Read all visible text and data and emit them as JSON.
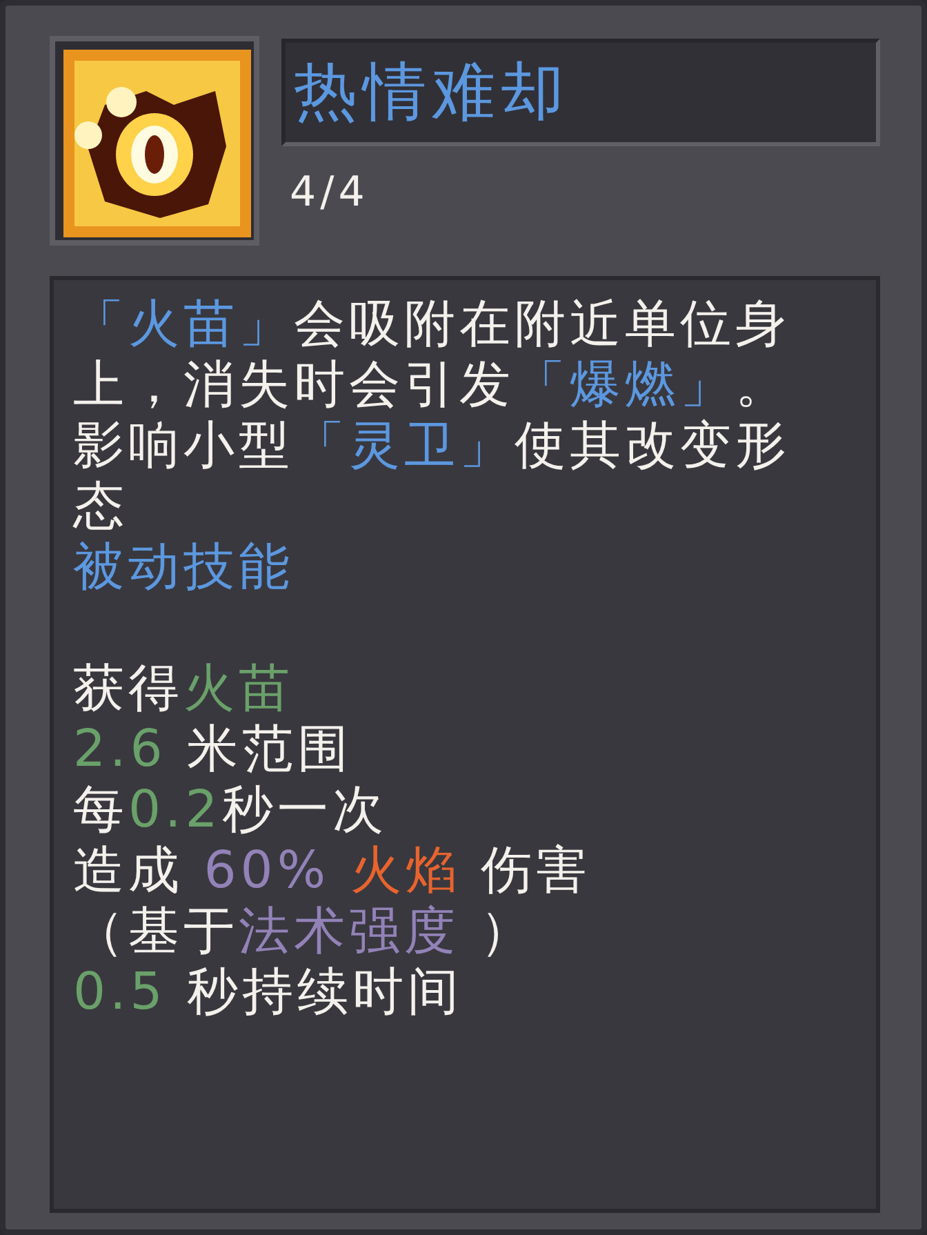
{
  "skill": {
    "title": "热情难却",
    "rank": "4/4"
  },
  "description": [
    {
      "text": "「火苗」",
      "kind": "keyword"
    },
    {
      "text": "会吸附在附近单位身上，消失时会引发",
      "kind": "plain"
    },
    {
      "text": "「爆燃」",
      "kind": "keyword"
    },
    {
      "text": "。影响小型",
      "kind": "plain"
    },
    {
      "text": "「灵卫」",
      "kind": "keyword"
    },
    {
      "text": "使其改变形态",
      "kind": "plain"
    }
  ],
  "skill_type": "被动技能",
  "stats": [
    [
      {
        "text": "获得",
        "kind": "plain"
      },
      {
        "text": "火苗",
        "kind": "value"
      }
    ],
    [
      {
        "text": "2.6",
        "kind": "value"
      },
      {
        "text": " 米范围",
        "kind": "plain"
      }
    ],
    [
      {
        "text": "每",
        "kind": "plain"
      },
      {
        "text": "0.2",
        "kind": "value"
      },
      {
        "text": "秒一次",
        "kind": "plain"
      }
    ],
    [
      {
        "text": "造成 ",
        "kind": "plain"
      },
      {
        "text": "60%",
        "kind": "scaling"
      },
      {
        "text": " 火焰",
        "kind": "fire"
      },
      {
        "text": " 伤害",
        "kind": "plain"
      }
    ],
    [
      {
        "text": "（基于",
        "kind": "plain"
      },
      {
        "text": "法术强度",
        "kind": "scaling"
      },
      {
        "text": " ）",
        "kind": "plain"
      }
    ],
    [
      {
        "text": "0.5",
        "kind": "value"
      },
      {
        "text": " 秒持续时间",
        "kind": "plain"
      }
    ]
  ]
}
